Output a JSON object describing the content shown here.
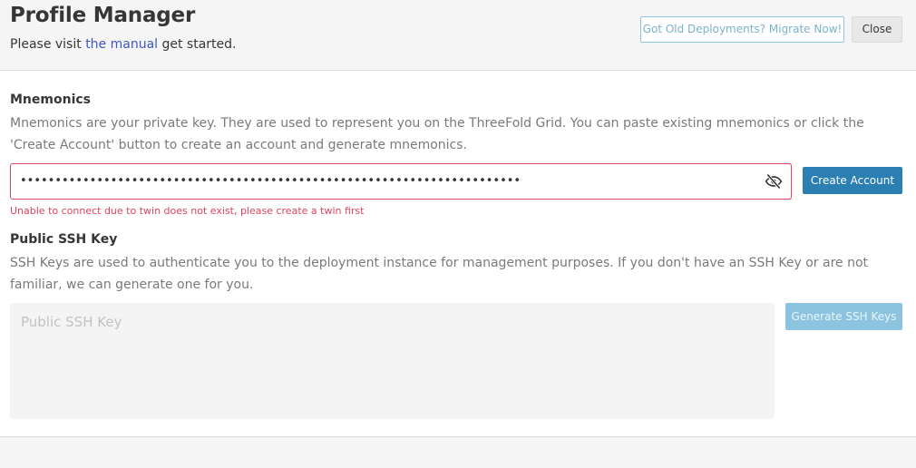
{
  "header": {
    "title": "Profile Manager",
    "subtitle_before": "Please visit ",
    "subtitle_link": "the manual",
    "subtitle_after": " get started.",
    "migrate_label": "Got Old Deployments? Migrate Now!",
    "close_label": "Close"
  },
  "mnemonics": {
    "label": "Mnemonics",
    "help": "Mnemonics are your private key. They are used to represent you on the ThreeFold Grid. You can paste existing mnemonics or click the 'Create Account' button to create an account and generate mnemonics.",
    "masked_value": "••••••••••••••••••••••••••••••••••••••••••••••••••••••••••••••••••••••••",
    "visibility_icon": "eye-off-icon",
    "create_label": "Create Account",
    "error": "Unable to connect due to twin does not exist, please create a twin first"
  },
  "ssh": {
    "label": "Public SSH Key",
    "help": "SSH Keys are used to authenticate you to the deployment instance for management purposes. If you don't have an SSH Key or are not familiar, we can generate one for you.",
    "placeholder": "Public SSH Key",
    "value": "",
    "generate_label": "Generate SSH Keys"
  },
  "colors": {
    "primary": "#2b7fb3",
    "primary_light": "#8cc4df",
    "danger": "#e0435c",
    "link": "#3e56c4"
  }
}
